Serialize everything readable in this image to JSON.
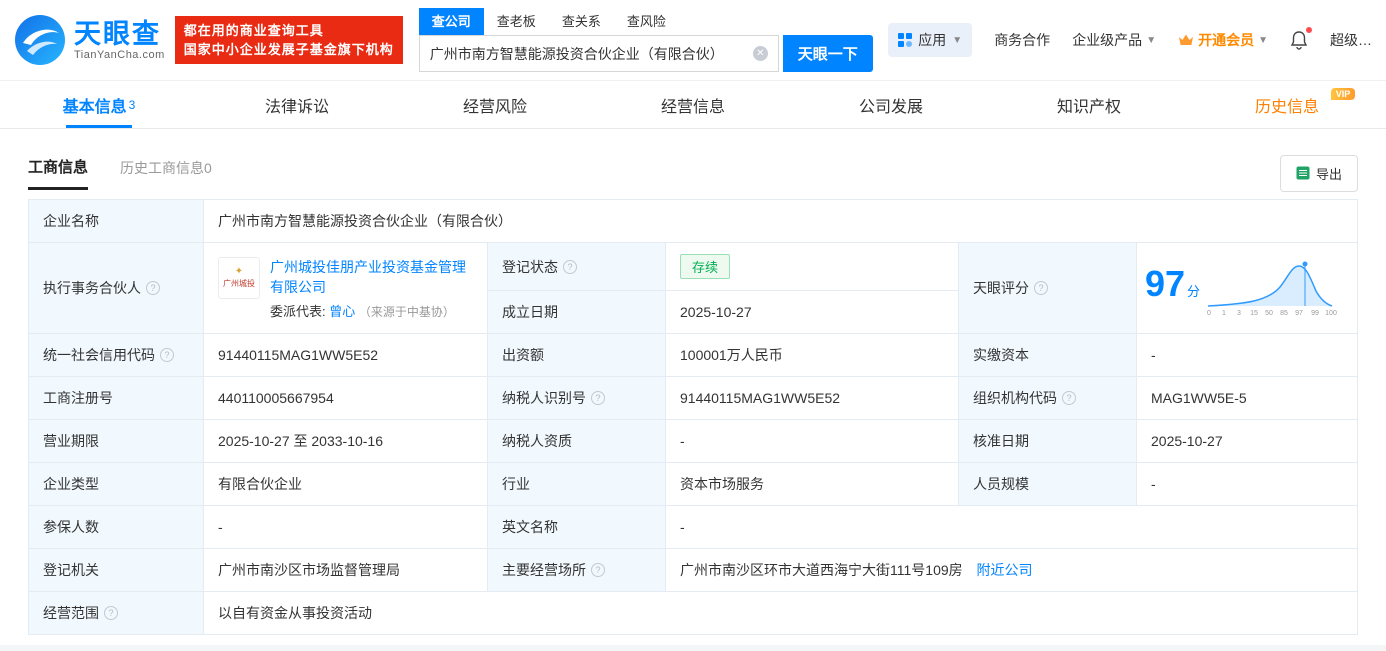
{
  "header": {
    "logo_title": "天眼查",
    "logo_subtitle": "TianYanCha.com",
    "slogan_line1": "都在用的商业查询工具",
    "slogan_line2": "国家中小企业发展子基金旗下机构",
    "search_tabs": [
      "查公司",
      "查老板",
      "查关系",
      "查风险"
    ],
    "search_value": "广州市南方智慧能源投资合伙企业（有限合伙）",
    "search_button": "天眼一下",
    "app_label": "应用",
    "biz_coop": "商务合作",
    "enterprise_product": "企业级产品",
    "open_vip": "开通会员",
    "super_vip": "超级…"
  },
  "tabs": {
    "basic": "基本信息",
    "basic_count": "3",
    "legal": "法律诉讼",
    "risk": "经营风险",
    "operation": "经营信息",
    "development": "公司发展",
    "ip": "知识产权",
    "history": "历史信息",
    "history_badge": "VIP"
  },
  "subtabs": {
    "business": "工商信息",
    "history_business": "历史工商信息0",
    "export": "导出"
  },
  "score": {
    "label": "天眼评分",
    "value": "97",
    "unit": "分",
    "axis_ticks": [
      "0",
      "1",
      "3",
      "15",
      "50",
      "85",
      "97",
      "99",
      "100"
    ]
  },
  "info": {
    "company_name_label": "企业名称",
    "company_name": "广州市南方智慧能源投资合伙企业（有限合伙）",
    "partner_label": "执行事务合伙人",
    "partner_logo_text": "广州城投",
    "partner_name": "广州城投佳朋产业投资基金管理有限公司",
    "rep_label": "委派代表:",
    "rep_name": "曾心",
    "rep_source": "（来源于中基协）",
    "reg_status_label": "登记状态",
    "reg_status": "存续",
    "establish_label": "成立日期",
    "establish_date": "2025-10-27",
    "credit_code_label": "统一社会信用代码",
    "credit_code": "91440115MAG1WW5E52",
    "capital_label": "出资额",
    "capital": "100001万人民币",
    "paid_label": "实缴资本",
    "paid": "-",
    "reg_no_label": "工商注册号",
    "reg_no": "440110005667954",
    "tax_id_label": "纳税人识别号",
    "tax_id": "91440115MAG1WW5E52",
    "org_code_label": "组织机构代码",
    "org_code": "MAG1WW5E-5",
    "term_label": "营业期限",
    "term": "2025-10-27 至 2033-10-16",
    "tax_qual_label": "纳税人资质",
    "tax_qual": "-",
    "approve_label": "核准日期",
    "approve_date": "2025-10-27",
    "type_label": "企业类型",
    "type": "有限合伙企业",
    "industry_label": "行业",
    "industry": "资本市场服务",
    "staff_label": "人员规模",
    "staff": "-",
    "insured_label": "参保人数",
    "insured": "-",
    "en_name_label": "英文名称",
    "en_name": "-",
    "authority_label": "登记机关",
    "authority": "广州市南沙区市场监督管理局",
    "address_label": "主要经营场所",
    "address": "广州市南沙区环市大道西海宁大街111号109房",
    "nearby": "附近公司",
    "scope_label": "经营范围",
    "scope": "以自有资金从事投资活动"
  }
}
